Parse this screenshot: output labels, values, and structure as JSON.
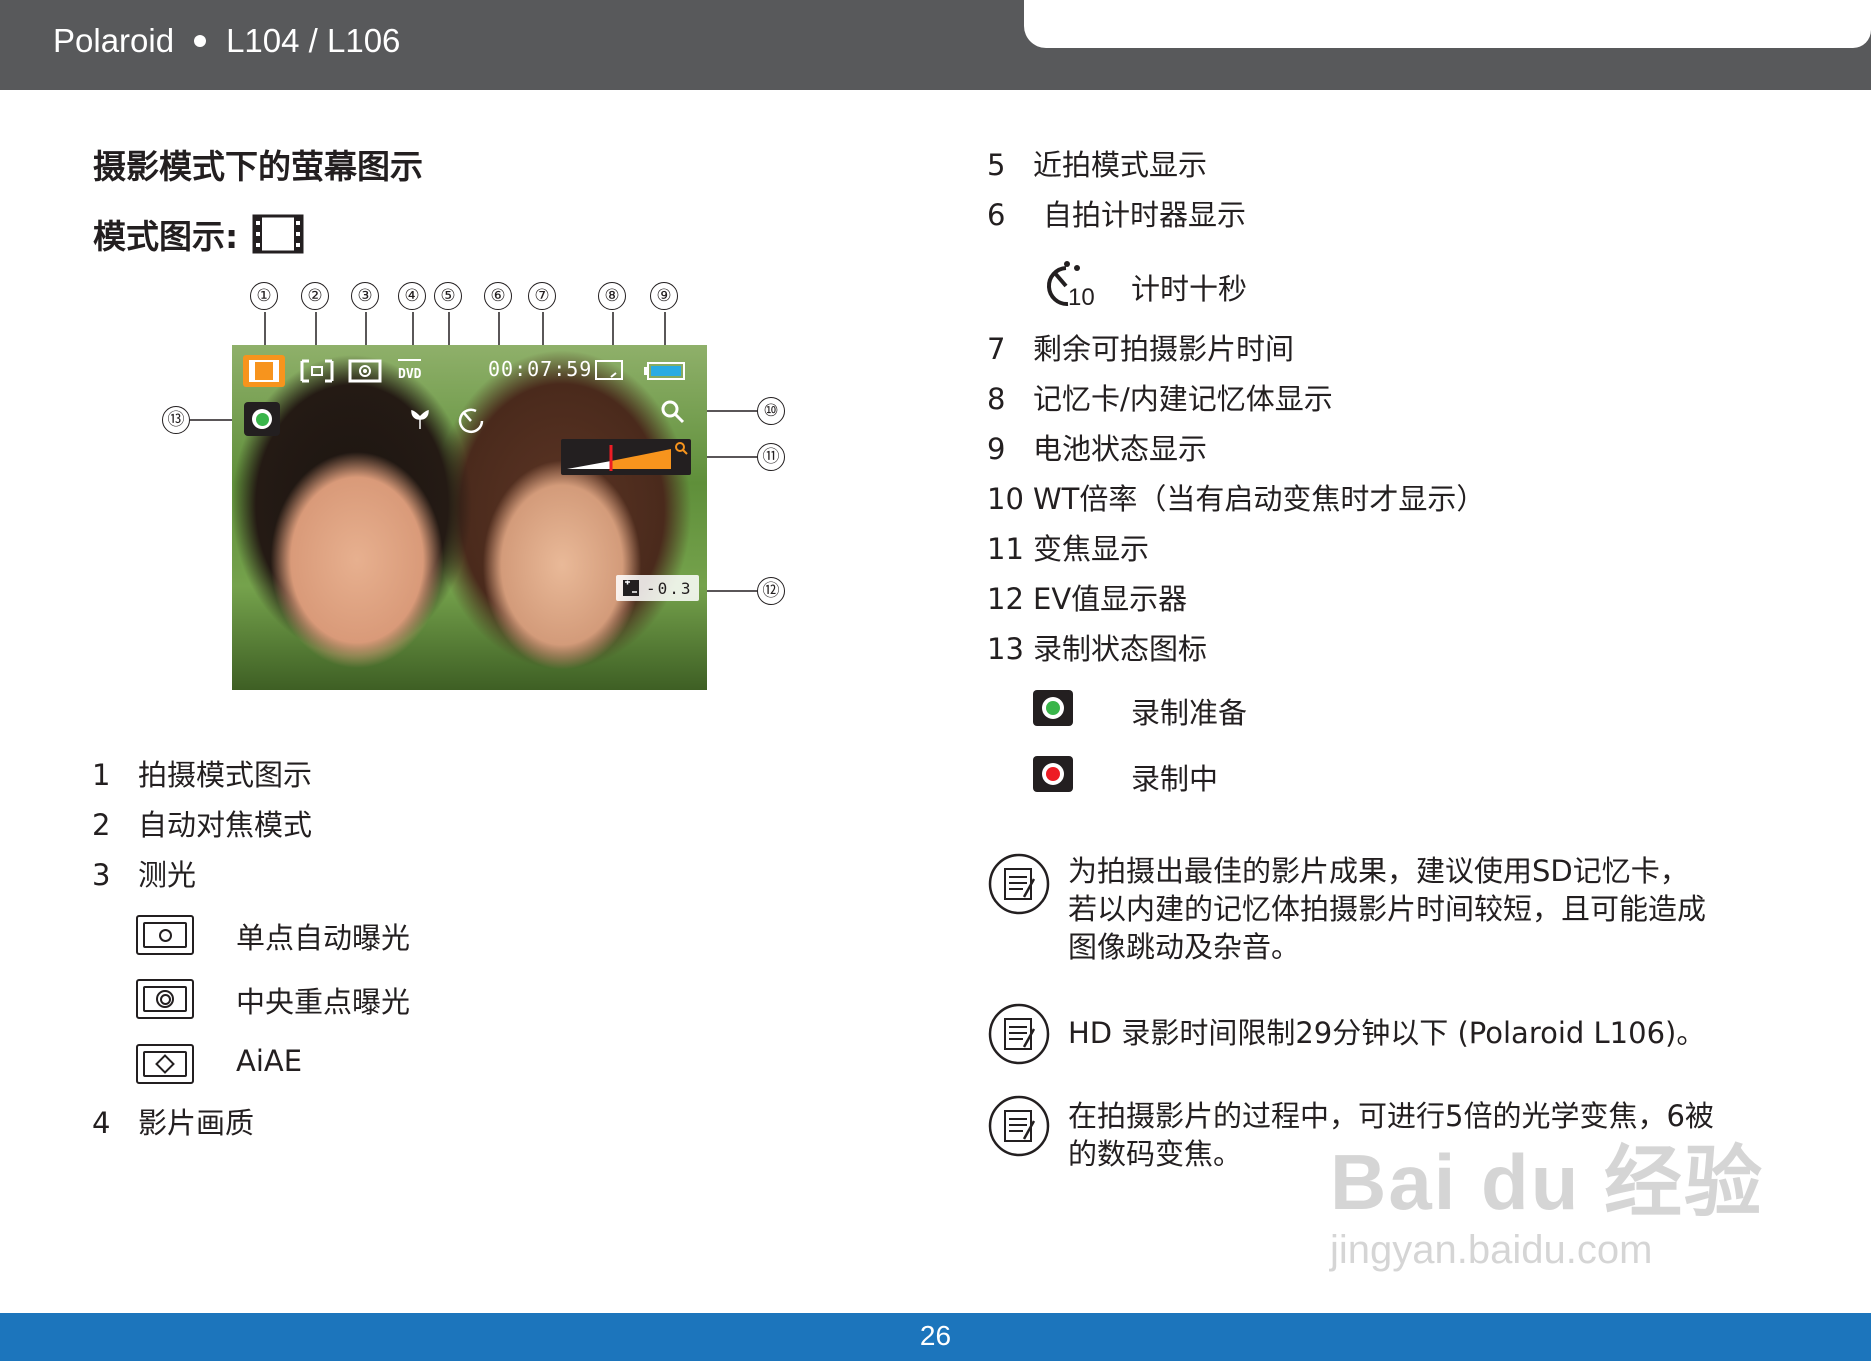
{
  "header": {
    "brand": "Polaroid",
    "model": "L104 / L106"
  },
  "footer": {
    "page_number": "26"
  },
  "title": "摄影模式下的萤幕图示",
  "mode_label": "模式图示:",
  "screen": {
    "timer": "00:07:59",
    "ev_value": "-0.3",
    "dvd_label": "DVD",
    "callouts": [
      "①",
      "②",
      "③",
      "④",
      "⑤",
      "⑥",
      "⑦",
      "⑧",
      "⑨",
      "⑩",
      "⑪",
      "⑫",
      "⑬"
    ]
  },
  "left_items": [
    {
      "num": "1",
      "text": "拍摄模式图示"
    },
    {
      "num": "2",
      "text": "自动对焦模式"
    },
    {
      "num": "3",
      "text": "测光"
    }
  ],
  "metering": [
    {
      "text": "单点自动曝光"
    },
    {
      "text": "中央重点曝光"
    },
    {
      "text": "AiAE"
    }
  ],
  "left_item_4": {
    "num": "4",
    "text": "影片画质"
  },
  "right_items_a": [
    {
      "num": "5",
      "text": "近拍模式显示"
    },
    {
      "num": "6",
      "text": "自拍计时器显示"
    }
  ],
  "timer_option": {
    "icon_label": "10",
    "text": "计时十秒"
  },
  "right_items_b": [
    {
      "num": "7",
      "text": "剩余可拍摄影片时间"
    },
    {
      "num": "8",
      "text": "记忆卡/内建记忆体显示"
    },
    {
      "num": "9",
      "text": "电池状态显示"
    },
    {
      "num": "10",
      "text": "WT倍率（当有启动变焦时才显示）"
    },
    {
      "num": "11",
      "text": "变焦显示"
    },
    {
      "num": "12",
      "text": "EV值显示器"
    },
    {
      "num": "13",
      "text": "录制状态图标"
    }
  ],
  "record_states": [
    {
      "text": "录制准备",
      "color": "#39b54a"
    },
    {
      "text": "录制中",
      "color": "#ed1c24"
    }
  ],
  "notes": [
    {
      "lines": [
        "为拍摄出最佳的影片成果，建议使用SD记忆卡，",
        "若以内建的记忆体拍摄影片时间较短，且可能造成",
        "图像跳动及杂音。"
      ]
    },
    {
      "lines": [
        "HD 录影时间限制29分钟以下 (Polaroid L106)。"
      ]
    },
    {
      "lines": [
        "在拍摄影片的过程中，可进行5倍的光学变焦，6被",
        "的数码变焦。"
      ]
    }
  ],
  "watermark": {
    "logo": "Bai du 经验",
    "url": "jingyan.baidu.com"
  },
  "colors": {
    "header_gray": "#58595b",
    "footer_blue": "#1c75bc",
    "osd_orange": "#f7941d"
  }
}
